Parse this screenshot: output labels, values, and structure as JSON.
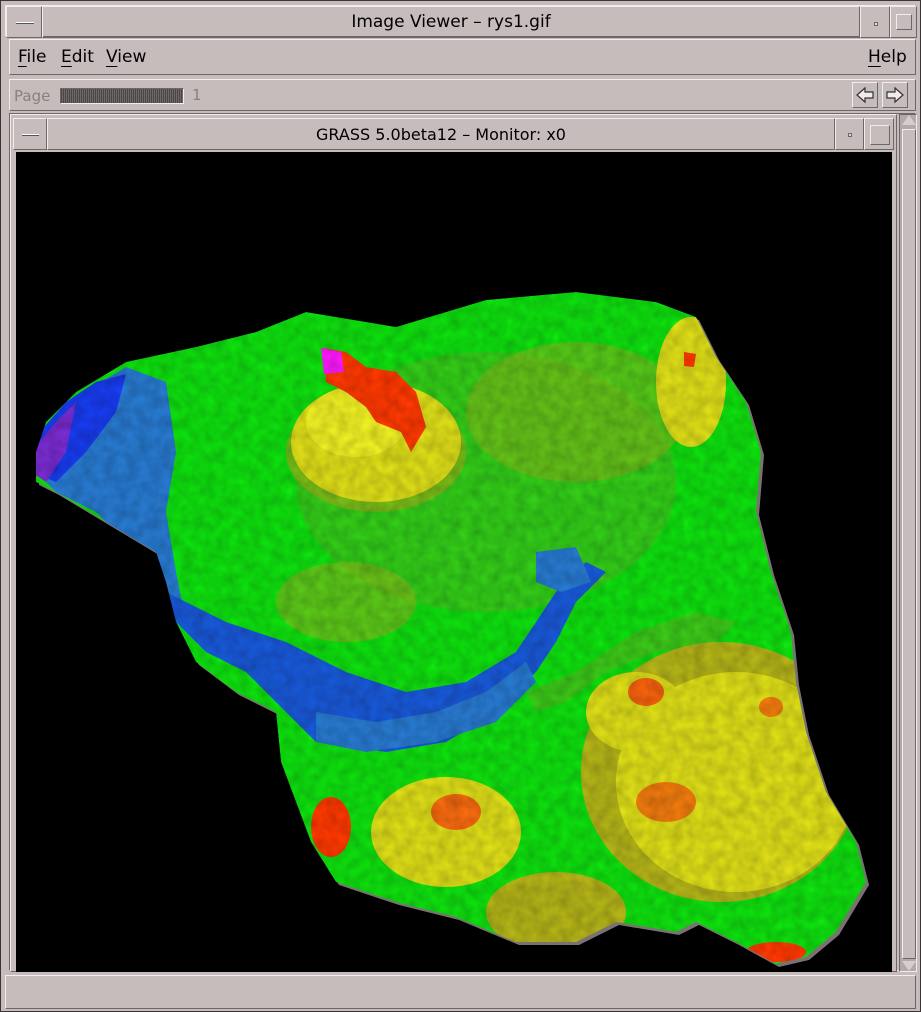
{
  "window": {
    "title": "Image Viewer – rys1.gif"
  },
  "menubar": {
    "file": {
      "mnemonic": "F",
      "rest": "ile"
    },
    "edit": {
      "mnemonic": "E",
      "rest": "dit"
    },
    "view": {
      "mnemonic": "V",
      "rest": "iew"
    },
    "help": {
      "mnemonic": "H",
      "rest": "elp"
    }
  },
  "pagebar": {
    "label": "Page",
    "page": "1",
    "prev_icon": "left-arrow-icon",
    "next_icon": "right-arrow-icon"
  },
  "monitor": {
    "title": "GRASS 5.0beta12 – Monitor: x0",
    "background": "#000000",
    "colormap": [
      "#7a2fd0",
      "#1e3cf0",
      "#1e5ad8",
      "#2a7ad0",
      "#18e018",
      "#3cc81c",
      "#8ab41e",
      "#b4b41e",
      "#dede1e",
      "#f0f028",
      "#ff3a10",
      "#ff1aff"
    ]
  }
}
